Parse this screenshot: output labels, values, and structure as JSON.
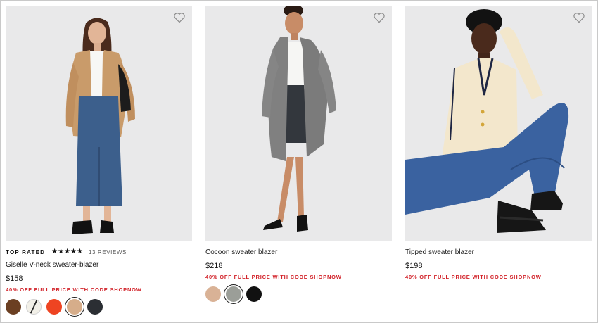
{
  "products": [
    {
      "top_rated": "TOP RATED",
      "stars": "★★★★★",
      "reviews": "13 REVIEWS",
      "name": "Giselle V-neck sweater-blazer",
      "price": "$158",
      "promo": "40% OFF FULL PRICE WITH CODE SHOPNOW",
      "swatches": [
        "#6b3f22",
        "#f2f0e8",
        "#ee4422",
        "#d6ad8a",
        "#2b2e33"
      ],
      "selected_swatch": 3
    },
    {
      "name": "Cocoon sweater blazer",
      "price": "$218",
      "promo": "40% OFF FULL PRICE WITH CODE SHOPNOW",
      "swatches": [
        "#d9b296",
        "#9b9e98",
        "#111111"
      ],
      "selected_swatch": 1
    },
    {
      "name": "Tipped sweater blazer",
      "price": "$198",
      "promo": "40% OFF FULL PRICE WITH CODE SHOPNOW",
      "swatches": [],
      "selected_swatch": null
    }
  ],
  "icons": {
    "wishlist": "heart-outline-icon"
  }
}
